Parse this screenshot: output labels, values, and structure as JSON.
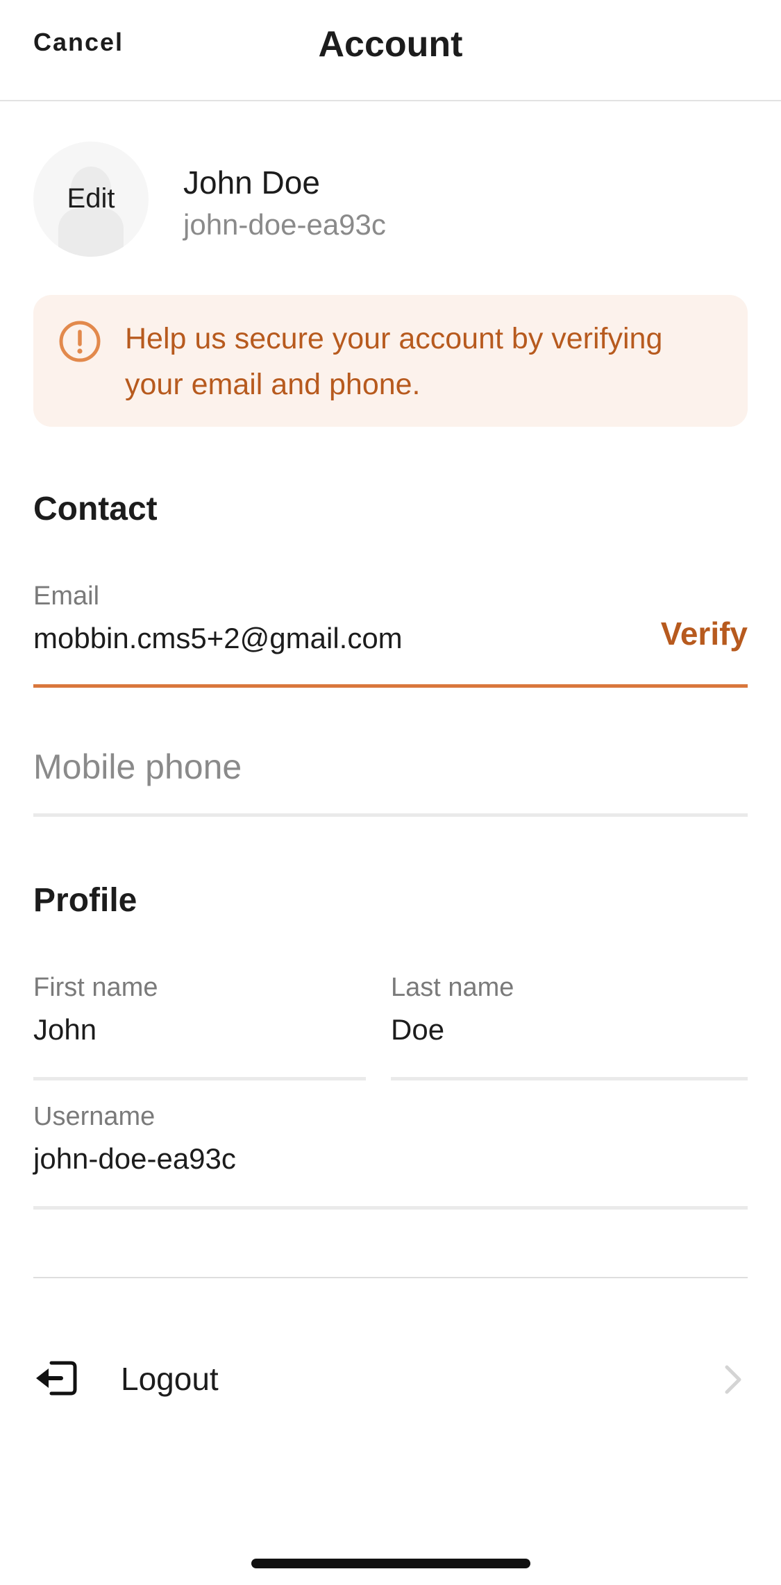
{
  "nav": {
    "cancel_label": "Cancel",
    "title": "Account"
  },
  "user": {
    "avatar_edit_label": "Edit",
    "name": "John Doe",
    "handle": "john-doe-ea93c"
  },
  "alert": {
    "icon": "exclamation-circle-icon",
    "message": "Help us secure your account by verifying your email and phone."
  },
  "contact": {
    "heading": "Contact",
    "email": {
      "label": "Email",
      "value": "mobbin.cms5+2@gmail.com",
      "action_label": "Verify"
    },
    "phone": {
      "placeholder": "Mobile phone",
      "value": ""
    }
  },
  "profile": {
    "heading": "Profile",
    "first_name": {
      "label": "First name",
      "value": "John"
    },
    "last_name": {
      "label": "Last name",
      "value": "Doe"
    },
    "username": {
      "label": "Username",
      "value": "john-doe-ea93c"
    }
  },
  "logout": {
    "label": "Logout",
    "icon": "logout-arrow-icon",
    "chevron_icon": "chevron-right-icon"
  },
  "colors": {
    "accent": "#b75a1e",
    "accent_underline": "#d9773c",
    "alert_background": "#fcf2ec",
    "alert_icon": "#e2894c",
    "text_primary": "#1c1c1c",
    "text_secondary": "#8a8a8a"
  }
}
